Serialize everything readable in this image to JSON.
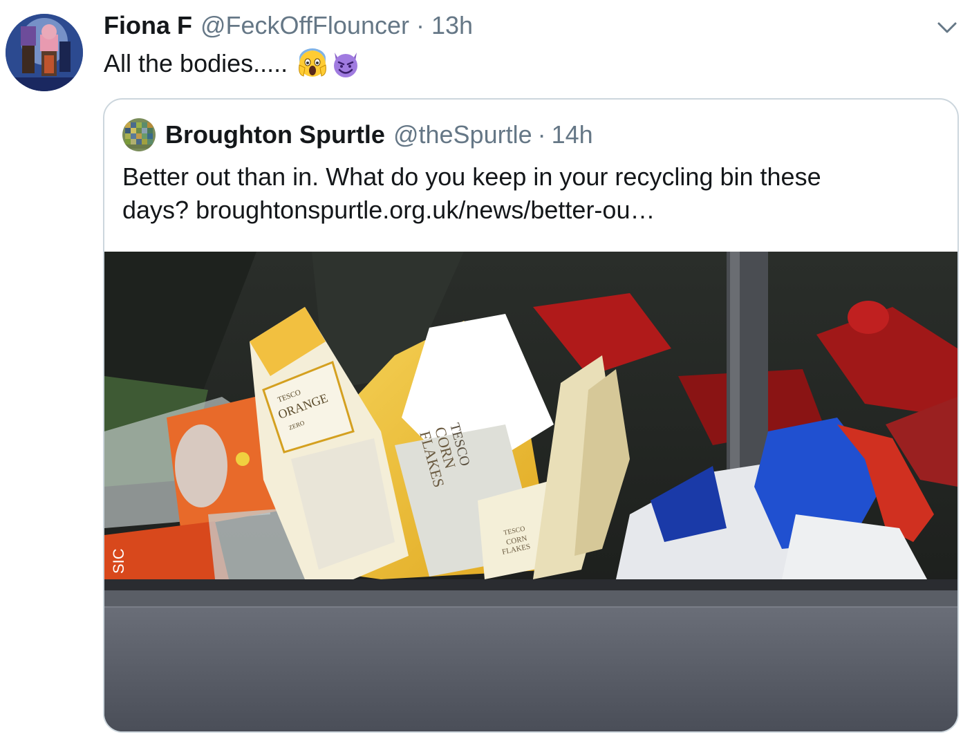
{
  "tweet": {
    "author_name": "Fiona F",
    "author_handle": "@FeckOffFlouncer",
    "separator": "·",
    "time": "13h",
    "text": "All the bodies.....",
    "emojis": [
      "face-screaming-in-fear-icon",
      "smiling-face-with-horns-icon"
    ],
    "menu_icon": "chevron-down-icon"
  },
  "quoted_tweet": {
    "author_name": "Broughton Spurtle",
    "author_handle": "@theSpurtle",
    "separator": "·",
    "time": "14h",
    "text_line1": "Better out than in. What do you keep in your recycling bin these",
    "text_line2_prefix": "days? ",
    "link": "broughtonspurtle.org.uk/news/better-ou…",
    "image_labels": {
      "bottle_brand": "TESCO",
      "bottle_flavour": "ORANGE",
      "bottle_variant": "ZERO",
      "box_brand": "TESCO",
      "box_product_line1": "CORN",
      "box_product_line2": "FLAKES",
      "small_box_brand": "TESCO",
      "small_box_line1": "CORN",
      "small_box_line2": "FLAKES",
      "bottle2_label": "SIC"
    }
  },
  "colors": {
    "text_primary": "#14171a",
    "text_secondary": "#657786",
    "border": "#ccd6dd"
  }
}
